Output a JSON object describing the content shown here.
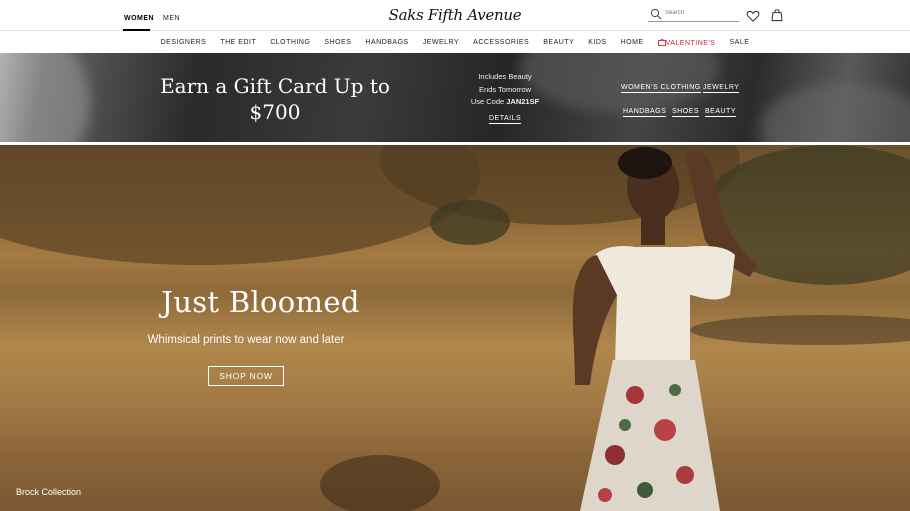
{
  "header": {
    "tabs": [
      {
        "label": "WOMEN",
        "active": true
      },
      {
        "label": "MEN",
        "active": false
      }
    ],
    "logo": "Saks Fifth Avenue",
    "search": {
      "placeholder": "Search",
      "value": ""
    },
    "icons": [
      "search-icon",
      "heart-icon",
      "shopping-bag-icon"
    ]
  },
  "nav": {
    "items": [
      {
        "label": "DESIGNERS"
      },
      {
        "label": "THE EDIT"
      },
      {
        "label": "CLOTHING"
      },
      {
        "label": "SHOES"
      },
      {
        "label": "HANDBAGS"
      },
      {
        "label": "JEWELRY"
      },
      {
        "label": "ACCESSORIES"
      },
      {
        "label": "BEAUTY"
      },
      {
        "label": "KIDS"
      },
      {
        "label": "HOME"
      },
      {
        "label": "VALENTINE'S",
        "color": "#d0243b",
        "icon": "heart-box-icon"
      },
      {
        "label": "SALE"
      }
    ]
  },
  "promo": {
    "title_line1": "Earn a Gift Card Up to",
    "title_line2": "$700",
    "detail_line1": "Includes Beauty",
    "detail_line2": "Ends Tomorrow",
    "detail_line3_prefix": "Use Code ",
    "detail_code": "JAN21SF",
    "details_link": "DETAILS",
    "links": {
      "womens_clothing": "WOMEN'S CLOTHING",
      "jewelry": "JEWELRY",
      "handbags": "HANDBAGS",
      "shoes": "SHOES",
      "beauty": "BEAUTY"
    }
  },
  "hero": {
    "title": "Just Bloomed",
    "subtitle": "Whimsical prints to wear now and later",
    "cta": "SHOP NOW",
    "caption": "Brock Collection"
  },
  "colors": {
    "accent_red": "#d0243b",
    "text": "#111111",
    "promo_bg": "#2e2e2e",
    "hero_field": "#a37a42"
  }
}
